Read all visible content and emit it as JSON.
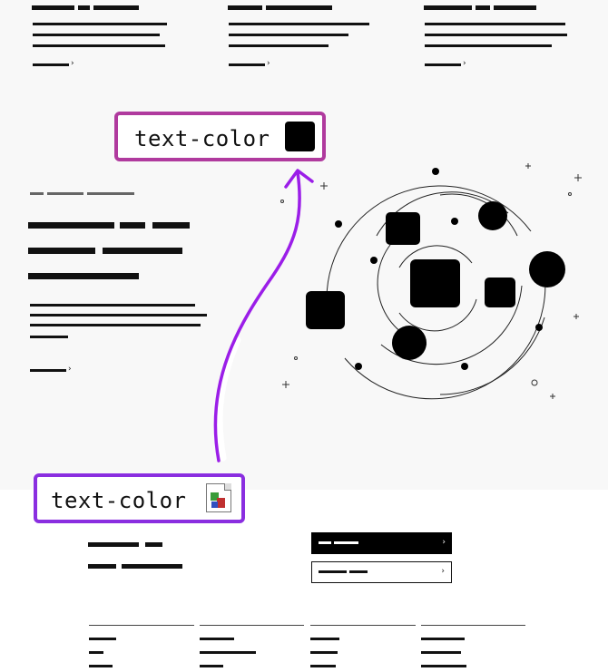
{
  "annotations": {
    "top_label": "text-color",
    "bottom_label": "text-color"
  },
  "colors": {
    "top_annotation_border": "#b03a9e",
    "bottom_annotation_border": "#8a2ee0",
    "arrow": "#9b1ee8",
    "swatch": "#000000"
  },
  "icons": {
    "top_swatch": "color-swatch-icon",
    "bottom_swatch": "broken-image-icon",
    "link_chevron": "chevron-right-icon",
    "arrow": "curved-arrow"
  }
}
